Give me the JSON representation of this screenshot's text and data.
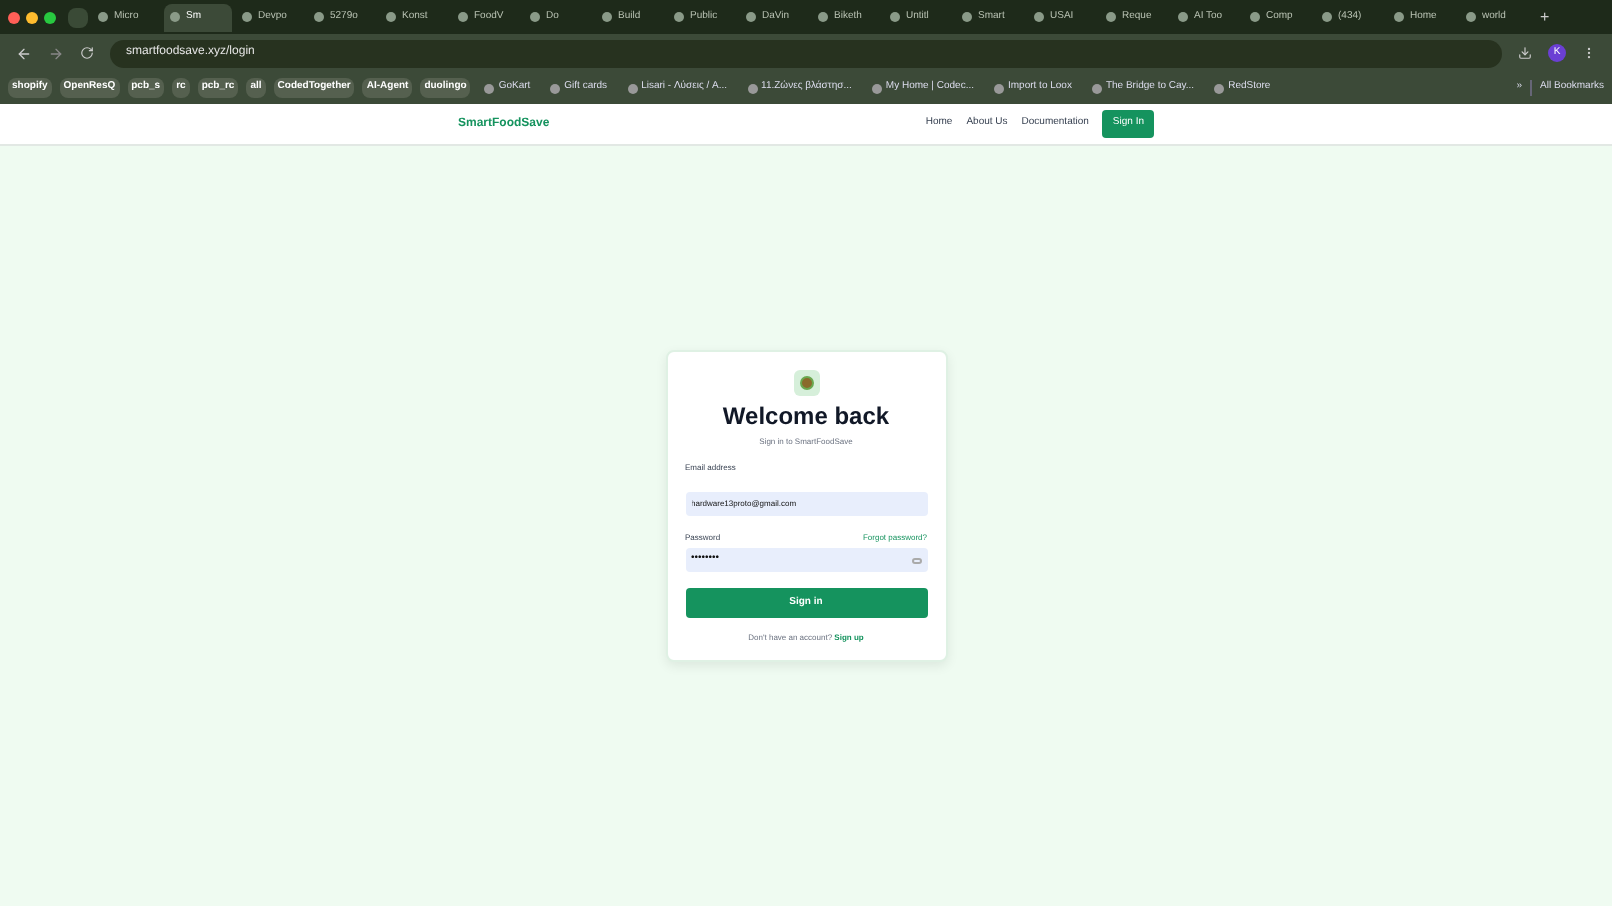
{
  "browser": {
    "tabs": [
      {
        "label": "Micro",
        "selected": false
      },
      {
        "label": "Sm",
        "selected": true
      },
      {
        "label": "Devpo",
        "selected": false
      },
      {
        "label": "5279o",
        "selected": false
      },
      {
        "label": "Konst",
        "selected": false
      },
      {
        "label": "FoodV",
        "selected": false
      },
      {
        "label": "Do",
        "selected": false
      },
      {
        "label": "Build",
        "selected": false
      },
      {
        "label": "Public",
        "selected": false
      },
      {
        "label": "DaVin",
        "selected": false
      },
      {
        "label": "Biketh",
        "selected": false
      },
      {
        "label": "Untitl",
        "selected": false
      },
      {
        "label": "Smart",
        "selected": false
      },
      {
        "label": "USAI",
        "selected": false
      },
      {
        "label": "Reque",
        "selected": false
      },
      {
        "label": "AI Too",
        "selected": false
      },
      {
        "label": "Comp",
        "selected": false
      },
      {
        "label": "(434)",
        "selected": false
      },
      {
        "label": "Home",
        "selected": false
      },
      {
        "label": "world",
        "selected": false
      }
    ],
    "new_tab": "+",
    "url": "smartfoodsave.xyz/login",
    "avatar": "K",
    "bookmarks": [
      {
        "label": "shopify",
        "kind": "chip"
      },
      {
        "label": "OpenResQ",
        "kind": "chip"
      },
      {
        "label": "pcb_s",
        "kind": "chip"
      },
      {
        "label": "rc",
        "kind": "chip"
      },
      {
        "label": "pcb_rc",
        "kind": "chip"
      },
      {
        "label": "all",
        "kind": "chip"
      },
      {
        "label": "CodedTogether",
        "kind": "chip"
      },
      {
        "label": "AI-Agent",
        "kind": "chip"
      },
      {
        "label": "duolingo",
        "kind": "chip"
      },
      {
        "label": "GoKart",
        "kind": "link"
      },
      {
        "label": "Gift cards",
        "kind": "link"
      },
      {
        "label": "Lisari - Λύσεις / A...",
        "kind": "link"
      },
      {
        "label": "11.Ζώνες βλάστησ...",
        "kind": "link"
      },
      {
        "label": "My Home | Codec...",
        "kind": "link"
      },
      {
        "label": "Import to Loox",
        "kind": "link"
      },
      {
        "label": "The Bridge to Cay...",
        "kind": "link"
      },
      {
        "label": "RedStore",
        "kind": "link"
      }
    ],
    "more": "»",
    "all_bookmarks": "All Bookmarks"
  },
  "nav": {
    "brand": "SmartFoodSave",
    "links": [
      "Home",
      "About Us",
      "Documentation"
    ],
    "sign_in": "Sign In"
  },
  "card": {
    "title": "Welcome back",
    "subtitle": "Sign in to SmartFoodSave",
    "email": {
      "label": "Email address",
      "value": "hardware13proto@gmail.com"
    },
    "password": {
      "label": "Password",
      "value": "••••••••",
      "forgot": "Forgot password?"
    },
    "submit": "Sign in",
    "footer": "Don't have an account?",
    "signup": "Sign up"
  }
}
